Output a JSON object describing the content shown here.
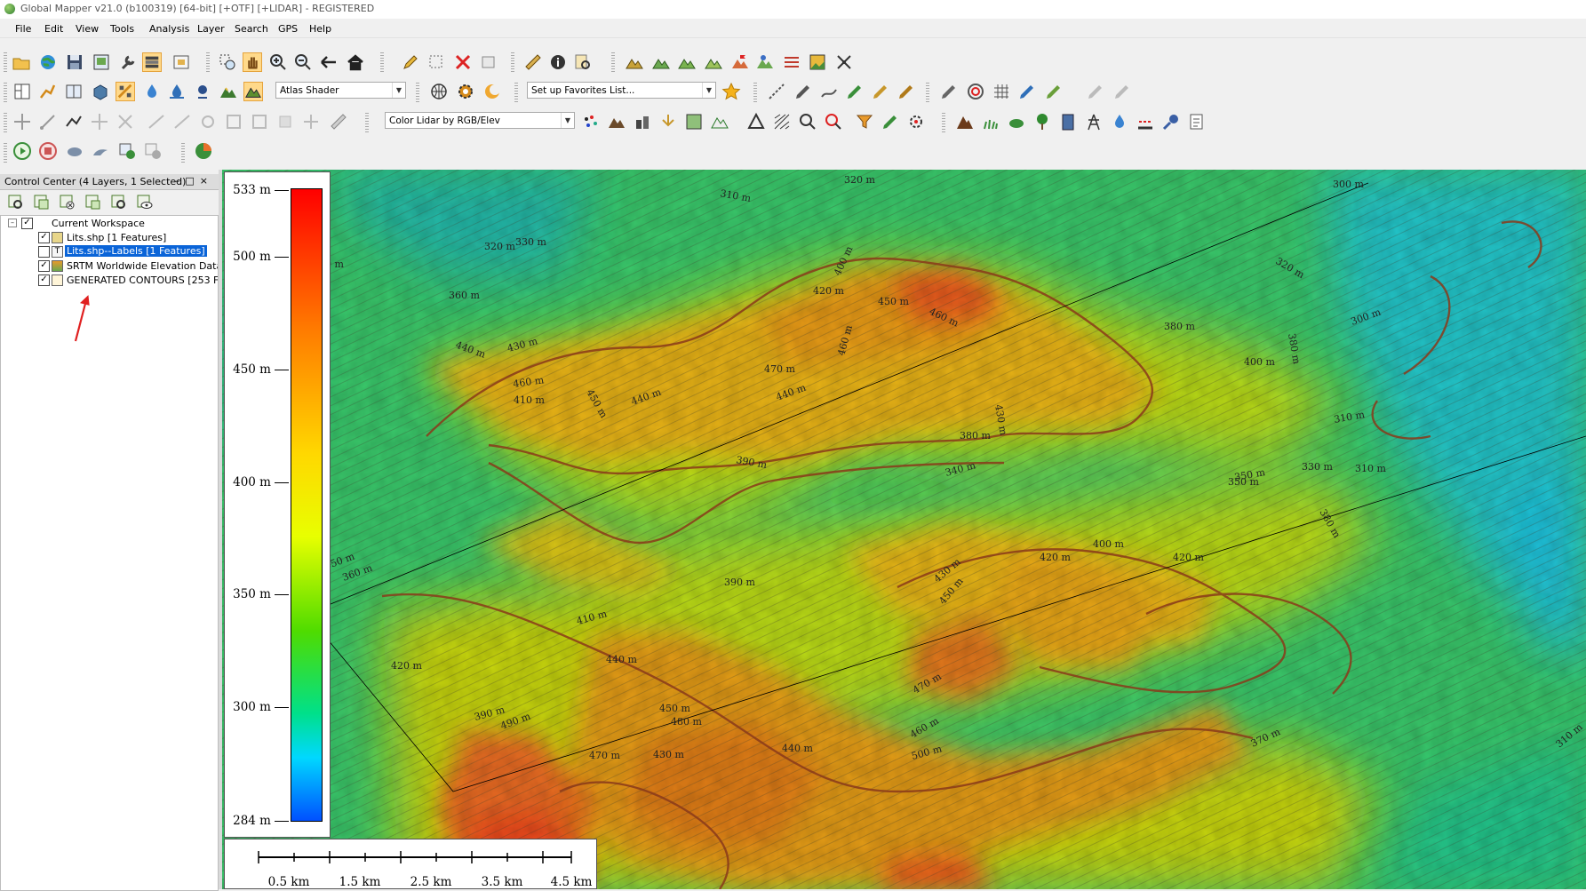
{
  "window": {
    "title": "Global Mapper v21.0 (b100319) [64-bit] [+OTF] [+LIDAR] - REGISTERED"
  },
  "menu": [
    "File",
    "Edit",
    "View",
    "Tools",
    "Analysis",
    "Layer",
    "Search",
    "GPS",
    "Help"
  ],
  "toolbars": {
    "shader_combo": "Atlas Shader",
    "favorites_combo": "Set up Favorites List...",
    "lidar_combo": "Color Lidar by RGB/Elev"
  },
  "control_center": {
    "title": "Control Center (4 Layers, 1 Selected)",
    "workspace": "Current Workspace",
    "layers": [
      {
        "name": "Lits.shp [1 Features]",
        "checked": true,
        "selected": false
      },
      {
        "name": "Lits.shp--Labels [1 Features]",
        "checked": false,
        "selected": true
      },
      {
        "name": "SRTM Worldwide Elevation Data",
        "checked": true,
        "selected": false
      },
      {
        "name": "GENERATED CONTOURS [253 Features]",
        "checked": true,
        "selected": false
      }
    ]
  },
  "legend": {
    "labels": [
      "533 m",
      "500 m",
      "450 m",
      "400 m",
      "350 m",
      "300 m",
      "284 m"
    ],
    "values": [
      533,
      500,
      450,
      400,
      350,
      300,
      284
    ],
    "min": 284,
    "max": 533,
    "colors": [
      "#ff0000",
      "#ff7a00",
      "#ffd800",
      "#4fdc00",
      "#00d8ff",
      "#0050ff"
    ]
  },
  "scalebar": {
    "labels": [
      "0.5 km",
      "1.5 km",
      "2.5 km",
      "3.5 km",
      "4.5 km"
    ]
  },
  "contour_labels": [
    "310 m",
    "320 m",
    "330 m",
    "320 m",
    "360 m",
    "330 m",
    "440 m",
    "430 m",
    "460 m",
    "410 m",
    "450 m",
    "440 m",
    "420 m",
    "450 m",
    "460 m",
    "400 m",
    "460 m",
    "470 m",
    "440 m",
    "390 m",
    "430 m",
    "380 m",
    "340 m",
    "380 m",
    "400 m",
    "380 m",
    "300 m",
    "320 m",
    "300 m",
    "310 m",
    "330 m",
    "310 m",
    "350 m",
    "380 m",
    "400 m",
    "420 m",
    "430 m",
    "420 m",
    "450 m",
    "390 m",
    "350 m",
    "360 m",
    "410 m",
    "440 m",
    "420 m",
    "470 m",
    "450 m",
    "480 m",
    "390 m",
    "490 m",
    "430 m",
    "440 m",
    "470 m",
    "460 m",
    "500 m",
    "370 m",
    "310 m",
    "350 m"
  ]
}
